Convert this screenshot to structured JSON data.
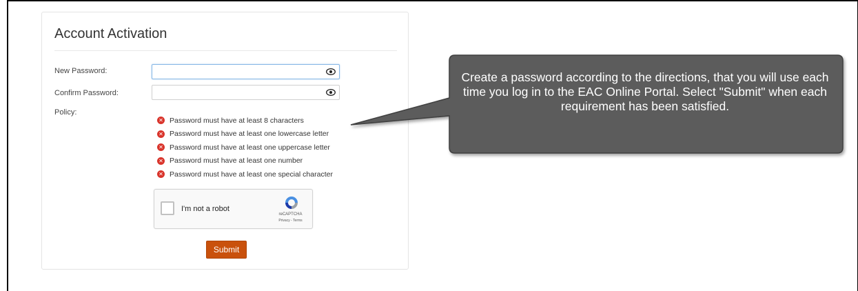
{
  "panel": {
    "title": "Account Activation"
  },
  "form": {
    "new_password_label": "New Password:",
    "confirm_password_label": "Confirm Password:",
    "policy_label": "Policy:",
    "new_password_value": "",
    "confirm_password_value": ""
  },
  "policy": {
    "items": [
      "Password must have at least 8 characters",
      "Password must have at least one lowercase letter",
      "Password must have at least one uppercase letter",
      "Password must have at least one number",
      "Password must have at least one special character"
    ],
    "status_icon": "x-circle-icon",
    "status_color": "#d9342b"
  },
  "captcha": {
    "label": "I'm not a robot",
    "brand": "reCAPTCHA",
    "terms": "Privacy - Terms"
  },
  "submit": {
    "label": "Submit",
    "color": "#c9510c"
  },
  "callout": {
    "text": "Create a password according to the directions, that you will use each time you log in to the EAC Online Portal. Select \"Submit\" when each requirement has been satisfied.",
    "background": "#5b5b5b"
  }
}
